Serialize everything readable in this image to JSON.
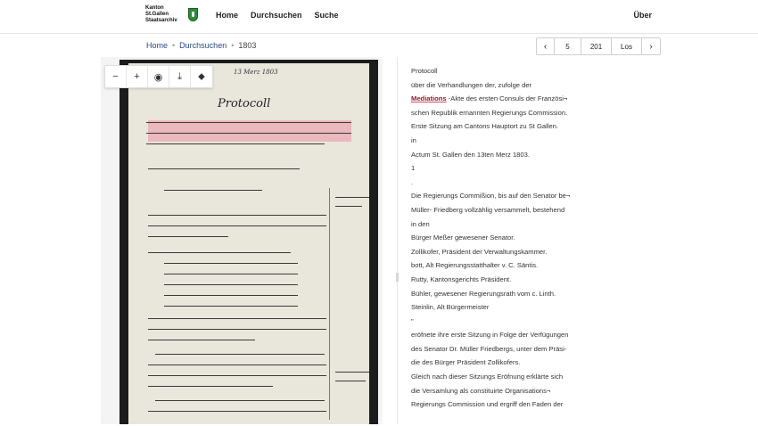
{
  "header": {
    "logo_text": "Kanton St.Gallen Staatsarchiv",
    "nav": [
      "Home",
      "Durchsuchen",
      "Suche"
    ],
    "right_link": "Über"
  },
  "breadcrumb": [
    "Home",
    "Durchsuchen",
    "1803"
  ],
  "pager": {
    "prev_icon": "‹",
    "current": "5",
    "total": "201",
    "go_label": "Los",
    "next_icon": "›"
  },
  "viewer": {
    "toolbar": [
      {
        "name": "zoom-out-icon",
        "glyph": "−"
      },
      {
        "name": "zoom-in-icon",
        "glyph": "+"
      },
      {
        "name": "eye-icon",
        "glyph": "◉"
      },
      {
        "name": "download-icon",
        "glyph": "⤓"
      },
      {
        "name": "tag-icon",
        "glyph": "⬥"
      }
    ],
    "handwritten_title": "Protocoll",
    "handwritten_date": "13 Merz 1803"
  },
  "transcript": {
    "lines": [
      "Protocoll",
      "über die Verhandlungen der, zufolge der",
      "__HL__ -Akte des ersten Consuls der Französi¬",
      "schen Republik ernannten Regierungs Commission.",
      "Erste Sitzung am Cantons Hauptort zu St Gallen.",
      "in",
      "Actum St. Gallen den 13ten Merz 1803.",
      "1",
      ".",
      "Die Regierungs Commißion, bis auf den Senator be¬",
      "Müller- Friedberg vollzählig versammelt, bestehend",
      "in den",
      "Bürger Meßer gewesener Senator.",
      "Zollikofer, Präsident der Verwaltungskammer.",
      "bott, Alt Regierungsstatthalter v. C. Säntis.",
      "Rutty, Kantonsgerichts Präsident.",
      "Bühler, gewesener Regierungsrath vom c. Linth.",
      "Steinlin, Alt Bürgermeister",
      "\"",
      "eröfnete ihre erste Sitzung in Folge der Verfügungen",
      "des Senator Dr. Müller Friedbergs, unter dem Präsi-",
      "die des Bürger Präsident Zollikofers.",
      "Gleich nach dieser Sitzungs Eröfnung erklärte sich",
      "die Versamlung als constituirte Organisations¬",
      "Regierungs Commission und ergriff den Faden der"
    ],
    "highlight_word": "Mediations",
    "highlight_color": "#d4495d"
  }
}
